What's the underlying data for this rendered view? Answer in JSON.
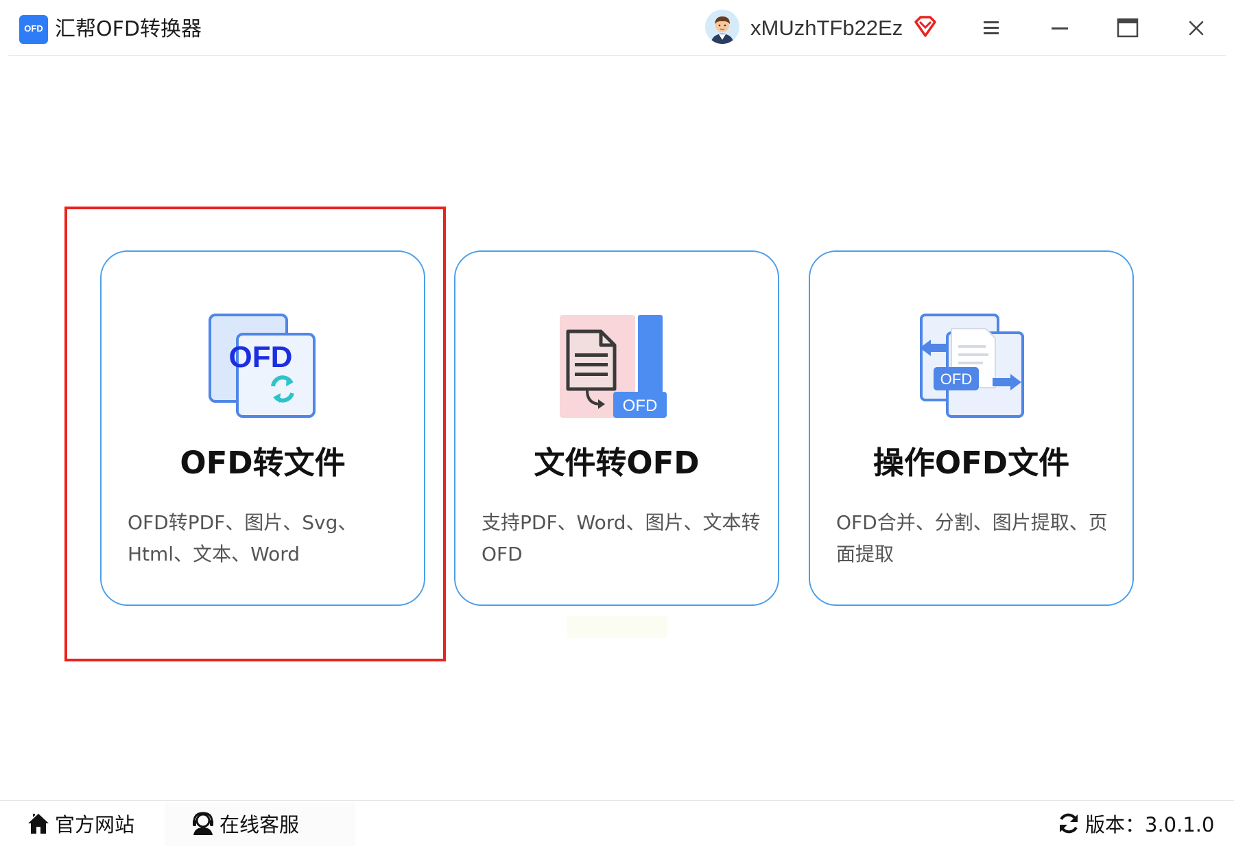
{
  "app": {
    "logo_text": "OFD",
    "title": "汇帮OFD转换器"
  },
  "header": {
    "username": "xMUzhTFb22Ez",
    "icons": [
      "avatar",
      "vip-diamond-icon",
      "menu-icon",
      "minimize-icon",
      "maximize-icon",
      "close-icon"
    ]
  },
  "cards": [
    {
      "title": "OFD转文件",
      "description": "OFD转PDF、图片、Svg、Html、文本、Word",
      "icon_label": "OFD",
      "icon": "ofd-convert-icon",
      "selected": true
    },
    {
      "title": "文件转OFD",
      "description": "支持PDF、Word、图片、文本转OFD",
      "icon_label": "OFD",
      "icon": "document-to-ofd-icon",
      "selected": false
    },
    {
      "title": "操作OFD文件",
      "description": "OFD合并、分割、图片提取、页面提取",
      "icon_label": "OFD",
      "icon": "ofd-operate-icon",
      "selected": false
    }
  ],
  "footer": {
    "website_label": "官方网站",
    "service_label": "在线客服",
    "version_label": "版本：3.0.1.0"
  },
  "colors": {
    "card_border": "#4b9fe8",
    "selection_border": "#e8231e",
    "accent_blue": "#2f7df6",
    "title_text": "#111111"
  }
}
